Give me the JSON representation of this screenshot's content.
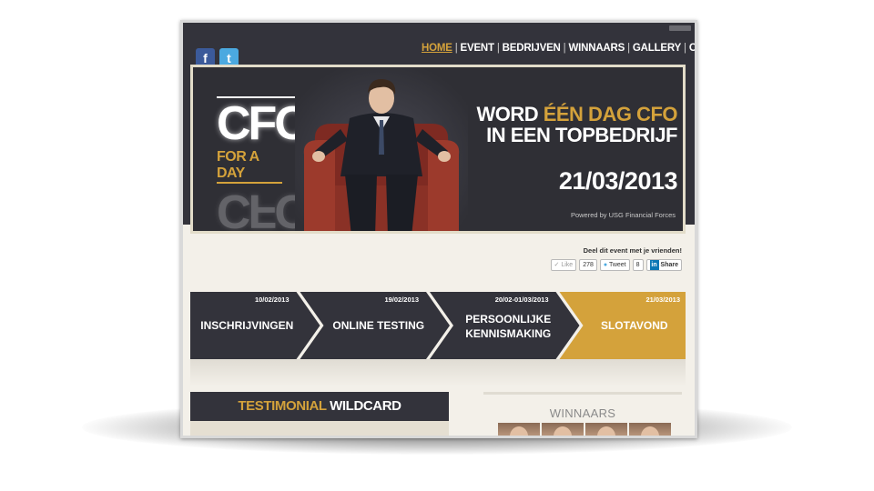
{
  "nav": {
    "items": [
      "HOME",
      "EVENT",
      "BEDRIJVEN",
      "WINNAARS",
      "GALLERY",
      "CONTACT"
    ],
    "active": "HOME",
    "separator": "|"
  },
  "social": {
    "facebook_icon": "f",
    "twitter_icon": "t"
  },
  "banner": {
    "logo_main": "CFO",
    "logo_sub": "FOR A DAY",
    "headline_pre": "WORD ",
    "headline_gold": "ÉÉN DAG CFO",
    "headline_line2": "IN EEN TOPBEDRIJF",
    "date": "21/03/2013",
    "powered": "Powered by USG Financial Forces"
  },
  "share": {
    "label": "Deel dit event met je vrienden!",
    "like_label": "Like",
    "like_count": "278",
    "tweet_label": "Tweet",
    "tweet_count": "8",
    "linkedin_label": "Share"
  },
  "steps": [
    {
      "date": "10/02/2013",
      "label": [
        "INSCHRIJVINGEN"
      ],
      "highlight": false
    },
    {
      "date": "19/02/2013",
      "label": [
        "ONLINE TESTING"
      ],
      "highlight": false
    },
    {
      "date": "20/02-01/03/2013",
      "label": [
        "PERSOONLIJKE",
        "KENNISMAKING"
      ],
      "highlight": false
    },
    {
      "date": "21/03/2013",
      "label": [
        "SLOTAVOND"
      ],
      "highlight": true
    }
  ],
  "testimonial": {
    "title_gold": "TESTIMONIAL",
    "title_rest": " WILDCARD"
  },
  "winners": {
    "title": "WINNAARS",
    "count": 4
  },
  "colors": {
    "dark": "#33333b",
    "gold": "#d4a23b",
    "background": "#f3f0e9"
  }
}
